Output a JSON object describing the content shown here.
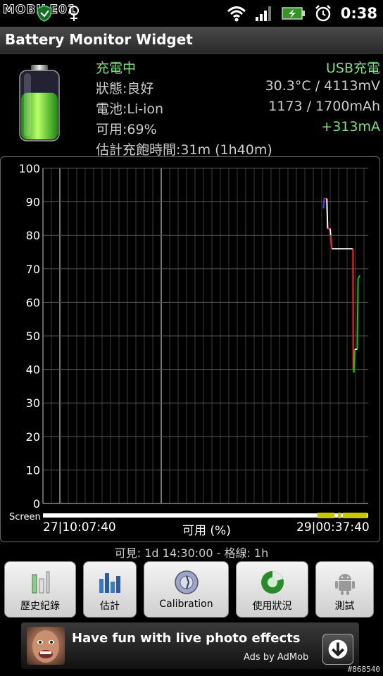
{
  "statusbar": {
    "logo_text": "MOBILE01",
    "time": "0:38",
    "icons": [
      "mobile01-logo",
      "shield-notification-icon",
      "usb-debug-icon",
      "wifi-icon",
      "signal-icon",
      "battery-charging-icon",
      "alarm-icon"
    ]
  },
  "app": {
    "title": "Battery Monitor Widget"
  },
  "info": {
    "status_left": "充電中",
    "status_right": "USB充電",
    "health_left": "狀態:良好",
    "health_right": "30.3°C / 4113mV",
    "battery_left": "電池:Li-ion",
    "battery_right": "1173 / 1700mAh",
    "avail_left": "可用:69%",
    "avail_right": "+313mA",
    "eta": "估計充飽時間:31m (1h40m)",
    "battery_level_fraction": 0.69
  },
  "chart_data": {
    "type": "line",
    "title": "",
    "ylabel": "",
    "xlabel": "可用 (%)",
    "ylim": [
      0,
      100
    ],
    "y_ticks": [
      "100",
      "90",
      "80",
      "70",
      "60",
      "50",
      "40",
      "30",
      "20",
      "10",
      "0"
    ],
    "x_start_label": "27|10:07:40",
    "x_end_label": "29|00:37:40",
    "screen_label": "Screen",
    "grid": true,
    "series": [
      {
        "color_segments": [
          "#3b4bff",
          "#ff2a2a",
          "#ffffff",
          "#00d000"
        ],
        "points_hours": [
          [
            33.2,
            88
          ],
          [
            33.3,
            91
          ],
          [
            33.6,
            91
          ],
          [
            33.7,
            82
          ],
          [
            34.0,
            82
          ],
          [
            34.05,
            80
          ],
          [
            34.2,
            76
          ],
          [
            36.7,
            76
          ],
          [
            36.72,
            40
          ],
          [
            36.8,
            39
          ],
          [
            36.85,
            42
          ],
          [
            36.9,
            46
          ],
          [
            37.2,
            46
          ],
          [
            37.3,
            67
          ],
          [
            37.5,
            68
          ]
        ]
      }
    ]
  },
  "footer": {
    "visible_range": "可見: 1d 14:30:00 - 格線: 1h"
  },
  "buttons": [
    {
      "label": "歷史紀錄",
      "icon": "history-icon"
    },
    {
      "label": "估計",
      "icon": "estimate-icon"
    },
    {
      "label": "Calibration",
      "icon": "calibration-icon"
    },
    {
      "label": "使用狀況",
      "icon": "usage-icon"
    },
    {
      "label": "測試",
      "icon": "android-test-icon"
    }
  ],
  "ad": {
    "title": "Have fun with live photo effects",
    "byline": "Ads by AdMob"
  },
  "watermark": "#868540"
}
